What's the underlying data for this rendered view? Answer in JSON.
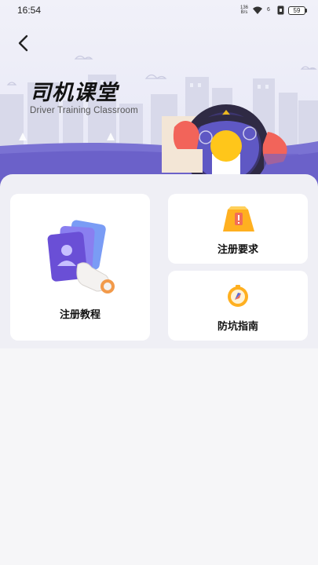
{
  "status_bar": {
    "time": "16:54",
    "net_speed_value": "136",
    "net_speed_unit": "B/s",
    "battery": "59"
  },
  "header": {
    "title": "司机课堂",
    "subtitle": "Driver Training Classroom"
  },
  "cards": {
    "tutorial": {
      "label": "注册教程",
      "icon": "id-card-hand-icon"
    },
    "requirements": {
      "label": "注册要求",
      "icon": "warning-sign-icon"
    },
    "guide": {
      "label": "防坑指南",
      "icon": "compass-icon"
    }
  },
  "colors": {
    "accent_purple": "#6b61c9",
    "wheel_dark": "#2f2a44",
    "wheel_yellow": "#ffc61a",
    "hand_red": "#f2645a"
  }
}
